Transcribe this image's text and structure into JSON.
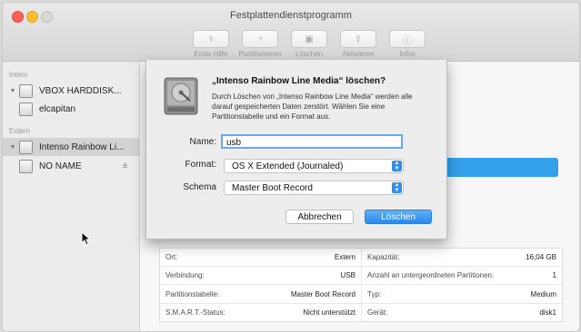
{
  "window": {
    "title": "Festplattendienstprogramm"
  },
  "toolbar": {
    "items": [
      {
        "label": "Erste Hilfe",
        "icon": "stethoscope-icon"
      },
      {
        "label": "Partitionieren",
        "icon": "partition-icon"
      },
      {
        "label": "Löschen",
        "icon": "erase-icon"
      },
      {
        "label": "Aktivieren",
        "icon": "mount-icon"
      },
      {
        "label": "Infos",
        "icon": "info-icon"
      }
    ]
  },
  "sidebar": {
    "section_intern": "Intern",
    "section_extern": "Extern",
    "items": [
      {
        "label": "VBOX HARDDISK..."
      },
      {
        "label": "elcapitan"
      },
      {
        "label": "Intenso Rainbow Li..."
      },
      {
        "label": "NO NAME"
      }
    ],
    "eject_symbol": "≙"
  },
  "dialog": {
    "title": "„Intenso Rainbow Line Media“ löschen?",
    "message": "Durch Löschen von „Intenso Rainbow Line Media“ werden alle darauf gespeicherten Daten zerstört. Wählen Sie eine Partitionstabelle und ein Format aus.",
    "name_label": "Name:",
    "name_value": "usb",
    "format_label": "Format:",
    "format_value": "OS X Extended (Journaled)",
    "scheme_label": "Schema",
    "scheme_value": "Master Boot Record",
    "cancel_label": "Abbrechen",
    "erase_label": "Löschen"
  },
  "info": {
    "rows": [
      {
        "k1": "Ort:",
        "v1": "Extern",
        "k2": "Kapazität:",
        "v2": "16,04 GB"
      },
      {
        "k1": "Verbindung:",
        "v1": "USB",
        "k2": "Anzahl an untergeordneten Partitionen:",
        "v2": "1"
      },
      {
        "k1": "Partitionstabelle:",
        "v1": "Master Boot Record",
        "k2": "Typ:",
        "v2": "Medium"
      },
      {
        "k1": "S.M.A.R.T.-Status:",
        "v1": "Nicht unterstützt",
        "k2": "Gerät:",
        "v2": "disk1"
      }
    ]
  },
  "colors": {
    "accent": "#2f8ff0",
    "selection_bar": "#33a0ec"
  }
}
